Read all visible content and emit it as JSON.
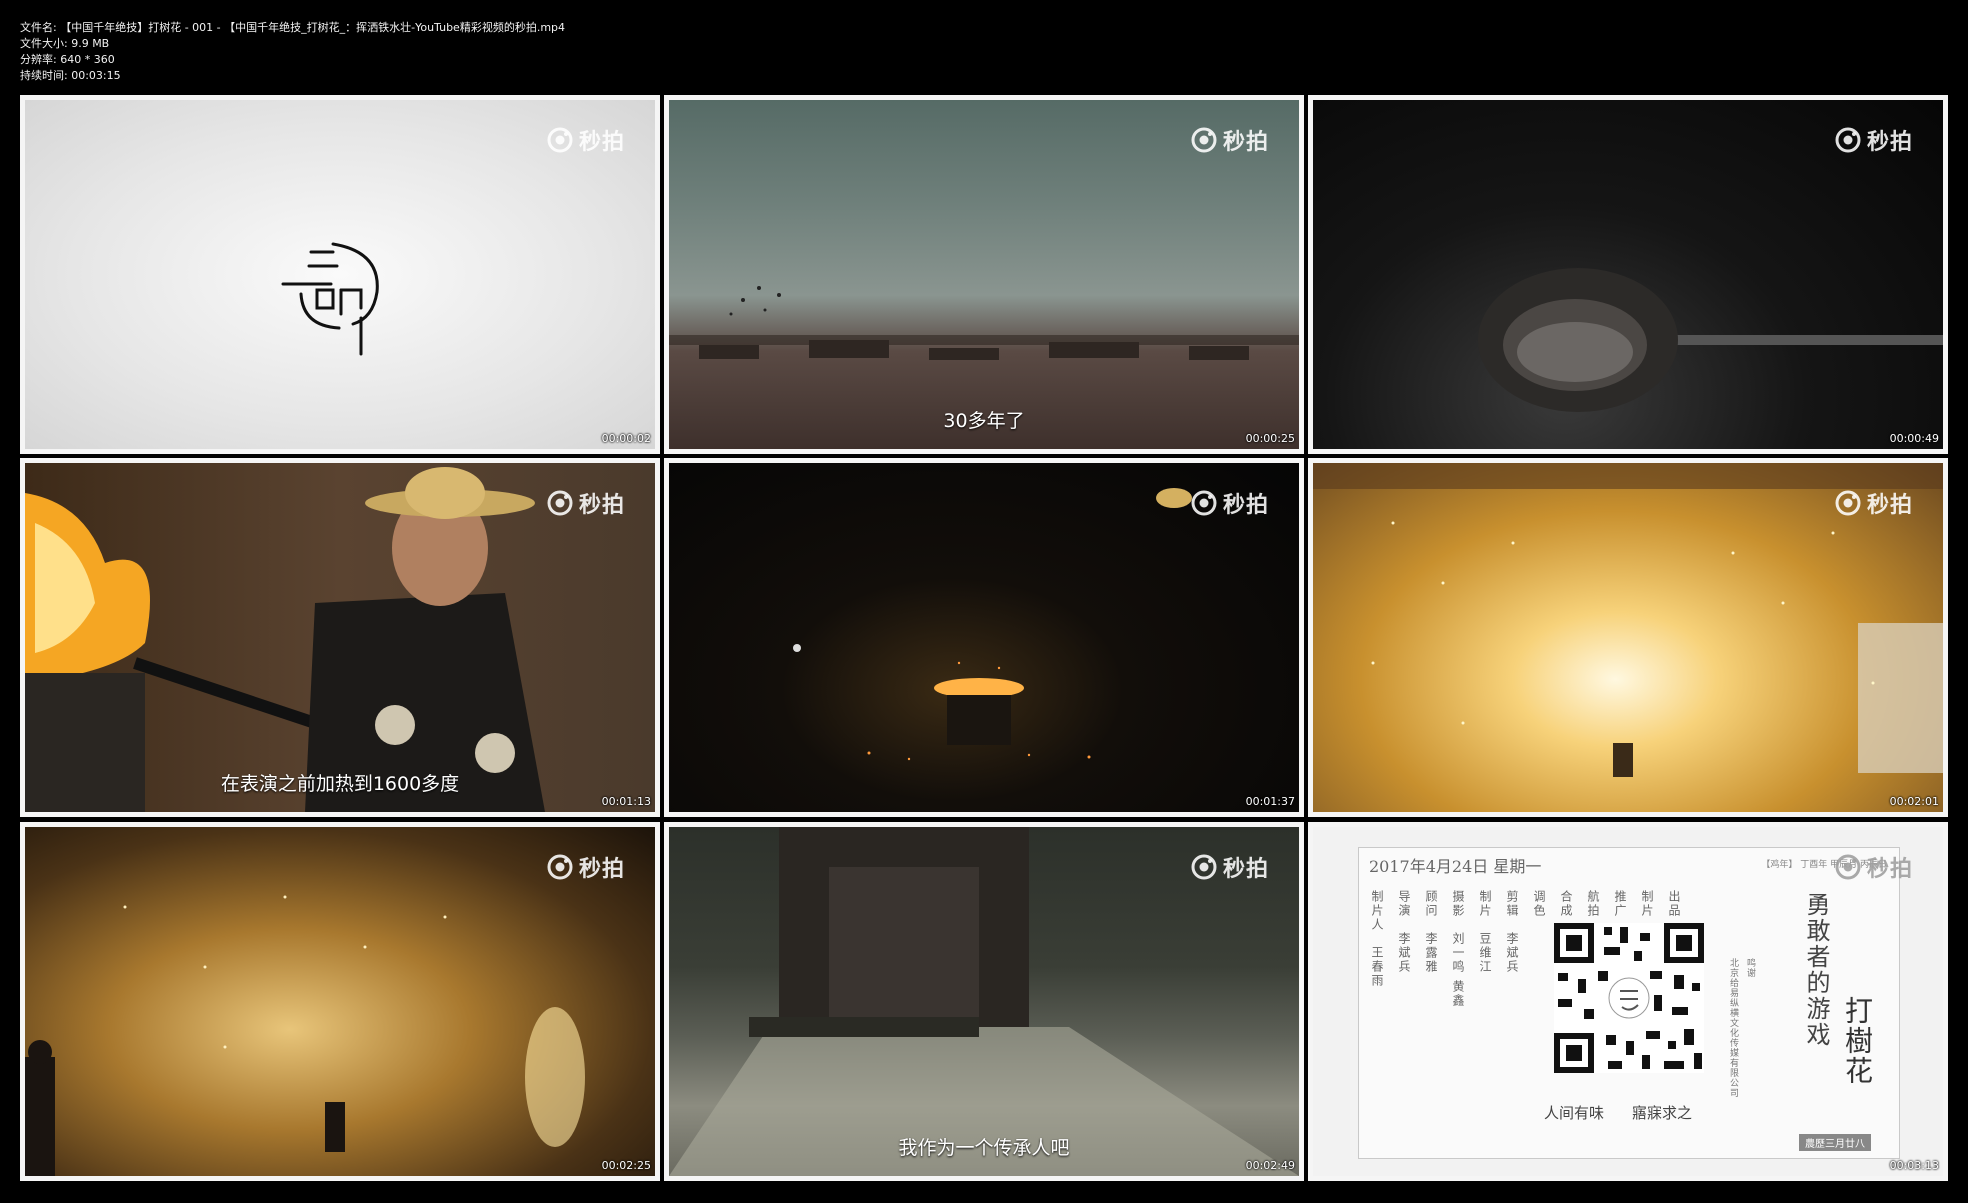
{
  "file_info": {
    "name_line": "文件名: 【中国千年绝技】打树花 - 001 - 【中国千年绝技_打树花_：挥洒铁水壮-YouTube精彩视频的秒拍.mp4",
    "size_line": "文件大小: 9.9 MB",
    "resolution_line": "分辨率: 640 * 360",
    "duration_line": "持续时间: 00:03:15"
  },
  "watermark": {
    "text": "秒拍",
    "icon": "miaopai-logo-icon"
  },
  "thumbnails": [
    {
      "timestamp": "00:00:02",
      "subtitle": ""
    },
    {
      "timestamp": "00:00:25",
      "subtitle": "30多年了"
    },
    {
      "timestamp": "00:00:49",
      "subtitle": ""
    },
    {
      "timestamp": "00:01:13",
      "subtitle": "在表演之前加热到1600多度"
    },
    {
      "timestamp": "00:01:37",
      "subtitle": ""
    },
    {
      "timestamp": "00:02:01",
      "subtitle": ""
    },
    {
      "timestamp": "00:02:25",
      "subtitle": ""
    },
    {
      "timestamp": "00:02:49",
      "subtitle": "我作为一个传承人吧"
    },
    {
      "timestamp": "00:03:13",
      "subtitle": ""
    }
  ],
  "end_card": {
    "date": "2017年4月24日  星期一",
    "tag": "【鸡年】 丁酉年 甲辰月 丙辰日",
    "credits": [
      {
        "role": "制片人",
        "name": "王春雨"
      },
      {
        "role": "导演",
        "name": "李斌兵"
      },
      {
        "role": "顾问",
        "name": "李露雅"
      },
      {
        "role": "摄影",
        "name": "刘一鸣 黄鑫"
      },
      {
        "role": "制片",
        "name": "豆维江"
      },
      {
        "role": "剪辑",
        "name": "李斌兵"
      },
      {
        "role": "调色",
        "name": ""
      },
      {
        "role": "合成",
        "name": ""
      },
      {
        "role": "航拍",
        "name": ""
      },
      {
        "role": "推广",
        "name": ""
      },
      {
        "role": "制片",
        "name": ""
      }
    ],
    "producer_label": "出品",
    "producer_org": "北京给易纵横文化传媒有限公司",
    "thanks_label": "鸣谢",
    "slogan_left": "人间有味",
    "slogan_right": "寤寐求之",
    "title_small": "勇敢者的游戏",
    "title_big": "打樹花",
    "stamp": "農歷三月廿八"
  }
}
